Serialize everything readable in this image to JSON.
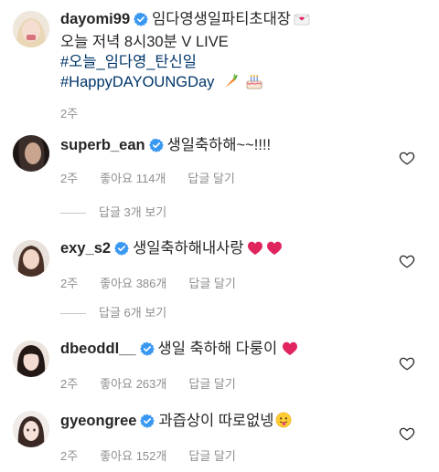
{
  "post": {
    "username": "dayomi99",
    "caption_line1": "임다영생일파티초대장",
    "caption_line2": "오늘 저녁 8시30분 V LIVE",
    "hashtag1": "#오늘_임다영_탄신일",
    "hashtag2": "#HappyDAYOUNGDay",
    "time": "2주",
    "emojis": [
      "love-letter-icon",
      "carrot-icon",
      "birthday-cake-icon"
    ]
  },
  "comments": [
    {
      "username": "superb_ean",
      "text": "생일축하해~~!!!!",
      "time": "2주",
      "likes": "좋아요 114개",
      "reply_label": "답글 달기",
      "view_replies": "답글 3개 보기"
    },
    {
      "username": "exy_s2",
      "text": "생일축하해내사랑",
      "time": "2주",
      "likes": "좋아요 386개",
      "reply_label": "답글 달기",
      "view_replies": "답글 6개 보기",
      "emojis": [
        "red-heart-icon",
        "red-heart-icon"
      ]
    },
    {
      "username": "dbeoddl__",
      "text": "생일 축하해 다룽이",
      "time": "2주",
      "likes": "좋아요 263개",
      "reply_label": "답글 달기",
      "emojis": [
        "red-heart-icon"
      ]
    },
    {
      "username": "gyeongree",
      "text": "과즙상이 따로없넹",
      "time": "2주",
      "likes": "좋아요 152개",
      "reply_label": "답글 달기",
      "emojis": [
        "tongue-face-icon"
      ]
    }
  ],
  "colors": {
    "verified": "#3897f0",
    "hashtag": "#003569",
    "meta": "#8e8e8e",
    "heart_emoji": "#e0245e"
  }
}
